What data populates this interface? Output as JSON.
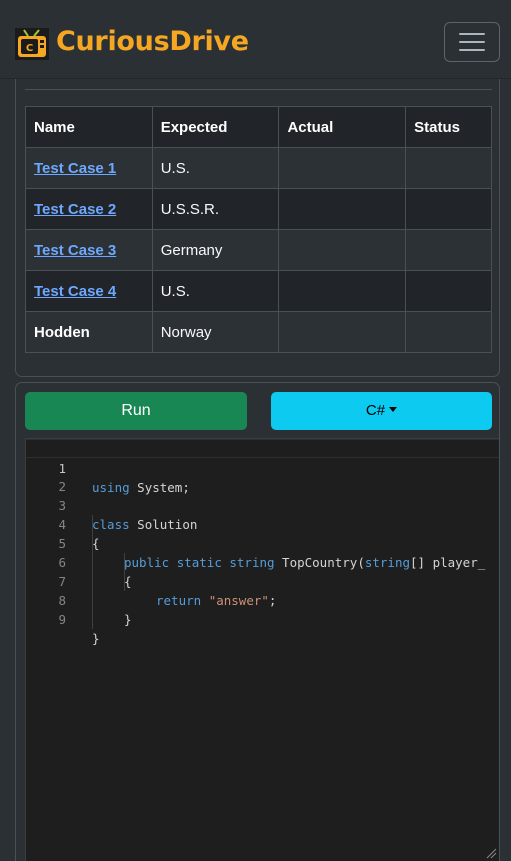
{
  "brand": {
    "name": "CuriousDrive"
  },
  "table": {
    "headers": [
      "Name",
      "Expected",
      "Actual",
      "Status"
    ],
    "rows": [
      {
        "name": "Test Case 1",
        "expected": "U.S.",
        "actual": "",
        "status": ""
      },
      {
        "name": "Test Case 2",
        "expected": "U.S.S.R.",
        "actual": "",
        "status": ""
      },
      {
        "name": "Test Case 3",
        "expected": "Germany",
        "actual": "",
        "status": ""
      },
      {
        "name": "Test Case 4",
        "expected": "U.S.",
        "actual": "",
        "status": ""
      },
      {
        "name": "Hodden",
        "expected": "Norway",
        "actual": "",
        "status": ""
      }
    ]
  },
  "toolbar": {
    "run_label": "Run",
    "language": "C#"
  },
  "editor": {
    "line_numbers": [
      "1",
      "2",
      "3",
      "4",
      "5",
      "6",
      "7",
      "8",
      "9"
    ],
    "tokens": {
      "l1_kw": "using",
      "l1_rest": " System;",
      "l3_kw": "class",
      "l3_rest": " Solution",
      "l4": "{",
      "l5_kw1": "public",
      "l5_kw2": "static",
      "l5_kw3": "string",
      "l5_name": " TopCountry(",
      "l5_kw4": "string",
      "l5_rest": "[] player_",
      "l6": "{",
      "l7_kw": "return",
      "l7_str": "\"answer\"",
      "l7_end": ";",
      "l8": "}",
      "l9": "}"
    }
  },
  "colors": {
    "brand": "#f5a623",
    "run_button": "#198754",
    "language_button": "#0dcaf0",
    "link": "#6ea8fe",
    "keyword": "#569cd6",
    "string": "#ce9178"
  }
}
